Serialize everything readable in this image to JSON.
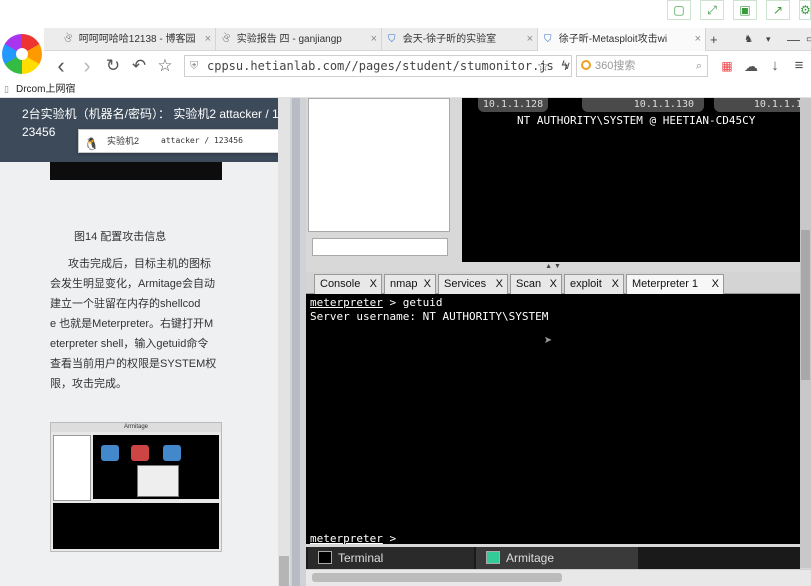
{
  "browser": {
    "tabs": [
      {
        "label": "呵呵呵哈哈12138 - 博客园",
        "close": "×"
      },
      {
        "label": "实验报告 四 - ganjiangp",
        "close": "×"
      },
      {
        "label": "会天-徐子昕的实验室",
        "close": "×"
      },
      {
        "label": "徐子昕-Metasploit攻击wi",
        "close": "×"
      }
    ],
    "new_tab": "+",
    "url": "cppsu.hetianlab.com//pages/student/stumonitor.js",
    "url_extra": "ϟ",
    "search_placeholder": "360搜索",
    "bookmark": "Drcom上网宿",
    "nav": {
      "back": "‹",
      "forward": "›",
      "reload": "↻",
      "undo": "↶",
      "star": "☆",
      "chevron": "∨"
    }
  },
  "article": {
    "header_line1": "2台实验机（机器名/密码）： 实验机2   attacker / 1",
    "header_line2": "23456",
    "dropdown": {
      "name": "实验机2",
      "cred": "attacker / 123456",
      "arrow": "▼"
    },
    "caption": "图14 配置攻击信息",
    "paragraph": [
      "攻击完成后，目标主机的图标",
      "会发生明显变化，Armitage会自动",
      "建立一个驻留在内存的shellcod",
      "e 也就是Meterpreter。右键打开M",
      "eterpreter shell，输入getuid命令",
      "查看当前用户的权限是SYSTEM权",
      "限，攻击完成。"
    ],
    "screenshot_title": "Armitage"
  },
  "armitage": {
    "hosts": [
      "10.1.1.128",
      "10.1.1.130",
      "10.1.1.1"
    ],
    "host_label": "NT AUTHORITY\\SYSTEM @ HEETIAN-CD45CY",
    "tabs": [
      {
        "label": "Console",
        "close": "X"
      },
      {
        "label": "nmap",
        "close": "X"
      },
      {
        "label": "Services",
        "close": "X"
      },
      {
        "label": "Scan",
        "close": "X"
      },
      {
        "label": "exploit",
        "close": "X"
      },
      {
        "label": "Meterpreter 1",
        "close": "X"
      }
    ],
    "console": {
      "prompt": "meterpreter",
      "cmd": " > getuid",
      "output": "Server username: NT AUTHORITY\\SYSTEM",
      "prompt_end": " >"
    },
    "split_arrows": "▲ ▼",
    "taskbar": [
      "Terminal",
      "Armitage"
    ]
  }
}
